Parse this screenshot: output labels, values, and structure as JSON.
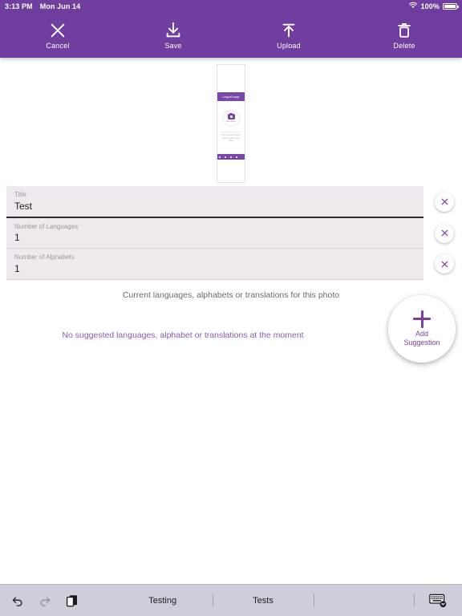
{
  "status_bar": {
    "time": "3:13 PM",
    "date": "Mon Jun 14",
    "battery_percent": "100%",
    "wifi_icon": "wifi-icon",
    "battery_icon": "battery-full-icon"
  },
  "colors": {
    "brand_purple": "#6f3e9e",
    "field_background": "#efe9ef",
    "suggestion_text": "#8a5bb5",
    "accent_purple": "#7a3fa5",
    "keyboard_bar": "#d0ccd9"
  },
  "toolbar": {
    "buttons": [
      {
        "label": "Cancel",
        "icon": "close-x-icon"
      },
      {
        "label": "Save",
        "icon": "download-save-icon"
      },
      {
        "label": "Upload",
        "icon": "upload-arrow-icon"
      },
      {
        "label": "Delete",
        "icon": "trash-icon"
      }
    ]
  },
  "photo": {
    "alt": "photo-thumbnail",
    "inner_header_title": "LinguaSnapp",
    "inner_camera_label": "Take Photo",
    "inner_caption": "Tap the camera button above to take a new photo"
  },
  "form": {
    "fields": [
      {
        "label": "Title",
        "value": "Test",
        "placeholder": "Title",
        "active": true,
        "clear_icon": "close-circle-icon"
      },
      {
        "label": "Number of Languages",
        "value": "1",
        "placeholder": "Number of Languages",
        "active": false,
        "clear_icon": "close-circle-icon"
      },
      {
        "label": "Number of Alphabets",
        "value": "1",
        "placeholder": "Number of Alphabets",
        "active": false,
        "clear_icon": "close-circle-icon"
      }
    ]
  },
  "main": {
    "current_note": "Current languages, alphabets or translations for this photo",
    "suggestion_note": "No suggested languages, alphabet or translations at the moment"
  },
  "fab": {
    "label_line1": "Add",
    "label_line2": "Suggestion",
    "icon": "plus-icon"
  },
  "keyboard_bar": {
    "undo_icon": "undo-arrow-icon",
    "redo_icon": "redo-arrow-icon",
    "paste_icon": "paste-clipboard-icon",
    "suggestions": [
      {
        "text": "Testing"
      },
      {
        "text": "Tests"
      },
      {
        "text": ""
      }
    ],
    "dismiss_icon": "keyboard-dismiss-icon"
  }
}
